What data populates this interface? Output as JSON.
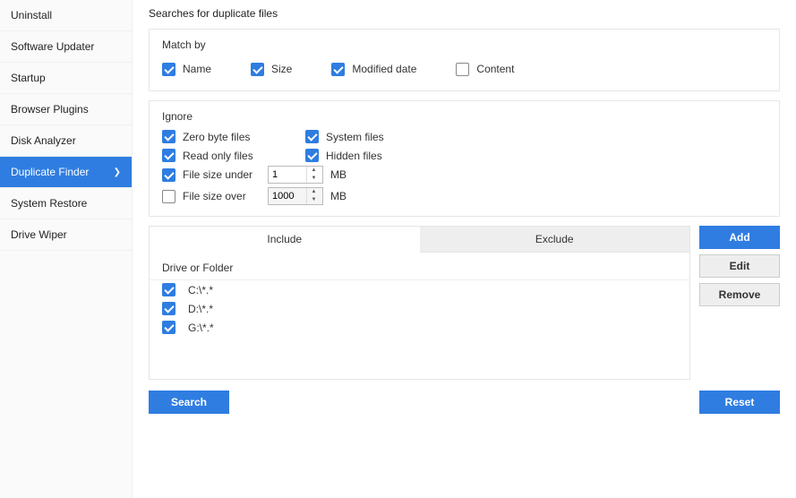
{
  "sidebar": {
    "items": [
      {
        "label": "Uninstall"
      },
      {
        "label": "Software Updater"
      },
      {
        "label": "Startup"
      },
      {
        "label": "Browser Plugins"
      },
      {
        "label": "Disk Analyzer"
      },
      {
        "label": "Duplicate Finder"
      },
      {
        "label": "System Restore"
      },
      {
        "label": "Drive Wiper"
      }
    ]
  },
  "header": {
    "title": "Searches for duplicate files"
  },
  "match": {
    "legend": "Match by",
    "name": "Name",
    "size": "Size",
    "modified": "Modified date",
    "content": "Content"
  },
  "ignore": {
    "legend": "Ignore",
    "zero": "Zero byte files",
    "system": "System files",
    "readonly": "Read only files",
    "hidden": "Hidden files",
    "under": "File size under",
    "over": "File size over",
    "under_value": "1",
    "over_value": "1000",
    "mb": "MB"
  },
  "tabs": {
    "include": "Include",
    "exclude": "Exclude"
  },
  "paths": {
    "header": "Drive or Folder",
    "items": [
      {
        "label": "C:\\*.*"
      },
      {
        "label": "D:\\*.*"
      },
      {
        "label": "G:\\*.*"
      }
    ]
  },
  "buttons": {
    "add": "Add",
    "edit": "Edit",
    "remove": "Remove",
    "search": "Search",
    "reset": "Reset"
  }
}
